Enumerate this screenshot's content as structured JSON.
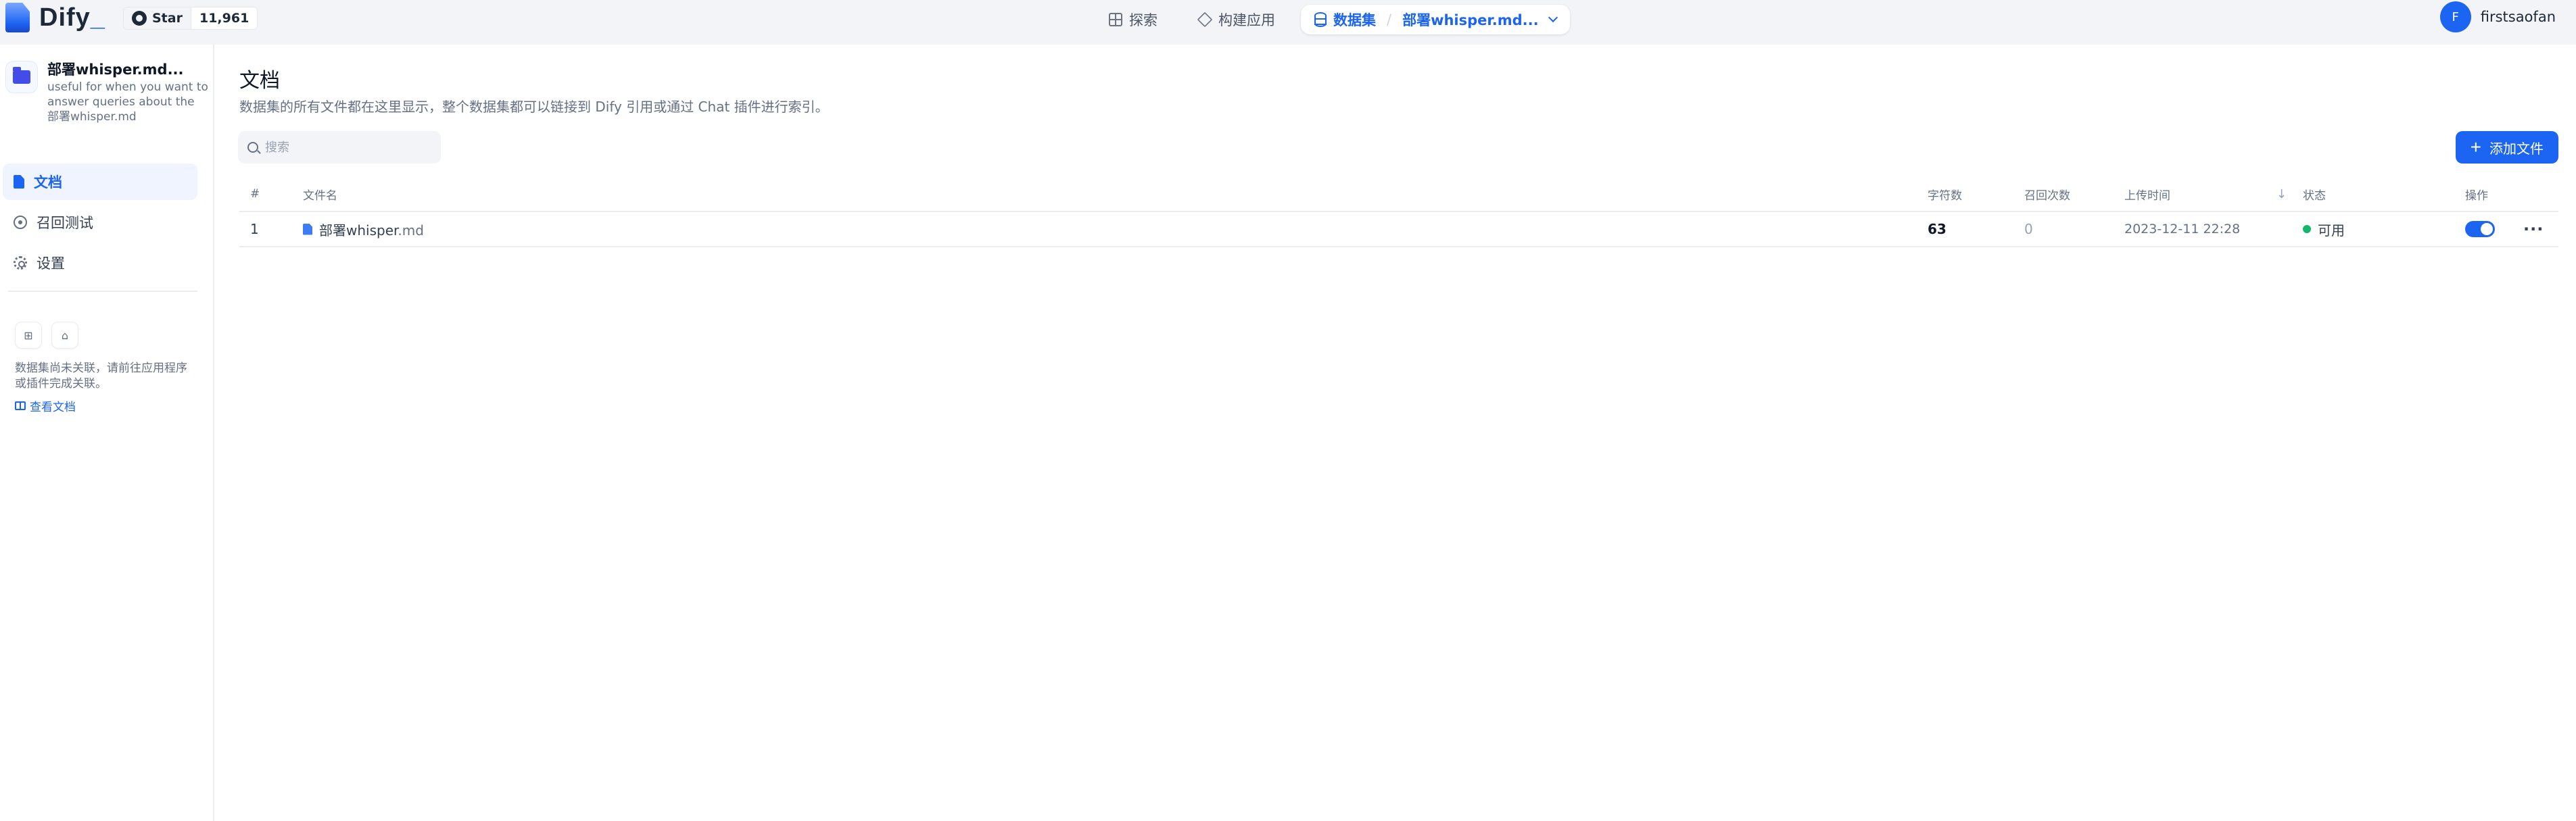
{
  "header": {
    "logo_text": "Dify",
    "github": {
      "star_label": "Star",
      "star_count": "11,961"
    },
    "nav": {
      "explore": "探索",
      "build": "构建应用",
      "dataset": "数据集",
      "dataset_current": "部署whisper.md..."
    },
    "user": {
      "avatar_letter": "F",
      "name": "firstsaofan"
    }
  },
  "sidebar": {
    "dataset_name": "部署whisper.md...",
    "dataset_desc": "useful for when you want to answer queries about the 部署whisper.md",
    "menu": [
      {
        "label": "文档",
        "icon": "document-icon",
        "active": true
      },
      {
        "label": "召回测试",
        "icon": "target-icon",
        "active": false
      },
      {
        "label": "设置",
        "icon": "gear-icon",
        "active": false
      }
    ],
    "unlinked_text": "数据集尚未关联，请前往应用程序或插件完成关联。",
    "doc_link": "查看文档"
  },
  "main": {
    "title": "文档",
    "description": "数据集的所有文件都在这里显示，整个数据集都可以链接到 Dify 引用或通过 Chat 插件进行索引。",
    "search_placeholder": "搜索",
    "add_button": "添加文件",
    "table": {
      "headers": {
        "index": "#",
        "name": "文件名",
        "chars": "字符数",
        "hits": "召回次数",
        "upload_time": "上传时间",
        "status": "状态",
        "actions": "操作"
      },
      "rows": [
        {
          "index": "1",
          "name": "部署whisper",
          "ext": ".md",
          "chars": "63",
          "hits": "0",
          "upload_time": "2023-12-11 22:28",
          "status": "可用",
          "enabled": true
        }
      ]
    }
  },
  "colors": {
    "primary": "#1c64f2",
    "status_ok": "#12b76a",
    "header_bg": "#f2f4f7"
  }
}
